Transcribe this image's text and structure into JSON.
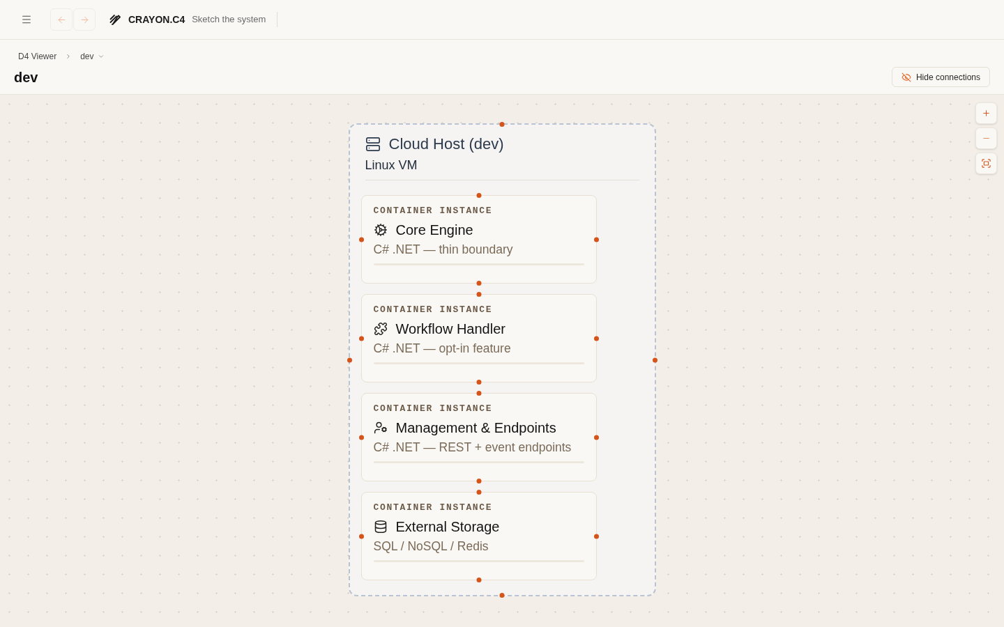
{
  "top_bar": {
    "navigation": [
      {
        "kind": "back",
        "disabled": true
      },
      {
        "kind": "forward",
        "disabled": true
      }
    ],
    "brand": "CRAYON.C4",
    "tagline": "Sketch the system"
  },
  "breadcrumb": [
    {
      "label": "D4 Viewer",
      "dropdown": false
    },
    {
      "label": "dev",
      "dropdown": true
    }
  ],
  "page_title": "dev",
  "toolbar": {
    "hide_connections_button": "Hide connections"
  },
  "diagram": {
    "host": {
      "title": "Cloud Host (dev)",
      "subtitle": "Linux VM",
      "containers": [
        {
          "kind": "engine",
          "type_label": "CONTAINER INSTANCE",
          "name": "Core Engine",
          "description": "C# .NET — thin boundary"
        },
        {
          "kind": "plugin",
          "type_label": "CONTAINER INSTANCE",
          "name": "Workflow Handler",
          "description": "C# .NET — opt-in feature"
        },
        {
          "kind": "service",
          "type_label": "CONTAINER INSTANCE",
          "name": "Management & Endpoints",
          "description": "C# .NET — REST + event endpoints"
        },
        {
          "kind": "storage",
          "type_label": "CONTAINER INSTANCE",
          "name": "External Storage",
          "description": "SQL / NoSQL / Redis"
        }
      ]
    }
  }
}
